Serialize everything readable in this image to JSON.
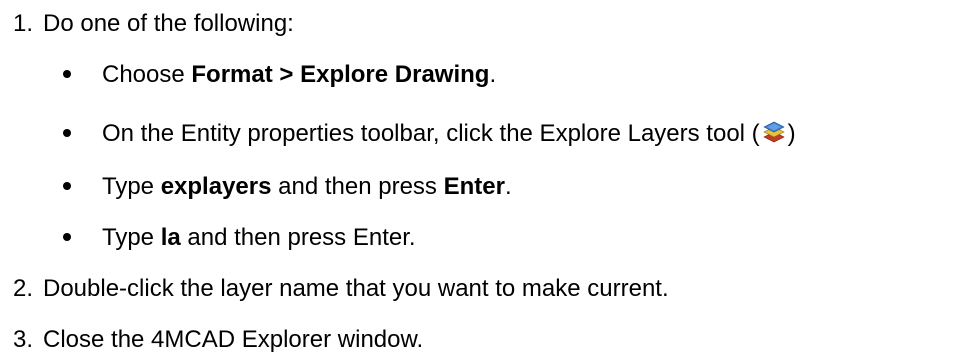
{
  "steps": [
    {
      "num": "1.",
      "text": "Do one of the following:"
    },
    {
      "num": "2.",
      "text": "Double-click the layer name that you want to make current."
    },
    {
      "num": "3.",
      "text": "Close the 4MCAD Explorer window."
    }
  ],
  "bullets": {
    "b1": {
      "pre": "Choose ",
      "bold": "Format > Explore Drawing",
      "post": "."
    },
    "b2": {
      "pre": "On the Entity properties toolbar, click the Explore Layers tool (",
      "post": ")",
      "icon": "explore-layers-icon"
    },
    "b3": {
      "pre": "Type ",
      "bold": "explayers",
      "mid": " and then press ",
      "bold2": "Enter",
      "post": "."
    },
    "b4": {
      "pre": "Type ",
      "bold": "la",
      "post": " and then press Enter."
    }
  }
}
